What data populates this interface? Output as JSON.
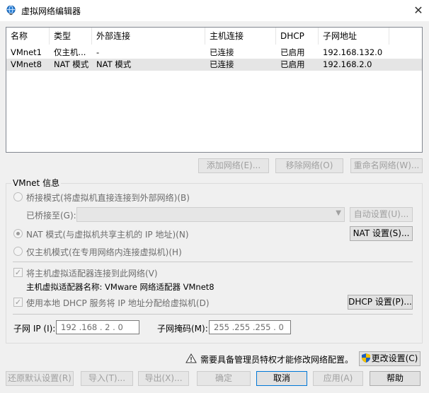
{
  "window": {
    "title": "虚拟网络编辑器",
    "close_glyph": "✕"
  },
  "table": {
    "headers": [
      "名称",
      "类型",
      "外部连接",
      "主机连接",
      "DHCP",
      "子网地址"
    ],
    "rows": [
      [
        "VMnet1",
        "仅主机...",
        "-",
        "已连接",
        "已启用",
        "192.168.132.0"
      ],
      [
        "VMnet8",
        "NAT 模式",
        "NAT 模式",
        "已连接",
        "已启用",
        "192.168.2.0"
      ]
    ],
    "selected_row": 1
  },
  "table_actions": {
    "add": "添加网络(E)...",
    "remove": "移除网络(O)",
    "rename": "重命名网络(W)..."
  },
  "vmnet_info": {
    "group_label": "VMnet 信息",
    "bridged_label": "桥接模式(将虚拟机直接连接到外部网络)(B)",
    "bridged_to_label": "已桥接至(G):",
    "bridged_to_value": "",
    "auto_settings": "自动设置(U)...",
    "nat_label": "NAT 模式(与虚拟机共享主机的 IP 地址)(N)",
    "nat_settings": "NAT 设置(S)...",
    "hostonly_label": "仅主机模式(在专用网络内连接虚拟机)(H)",
    "connect_adapter_label": "将主机虚拟适配器连接到此网络(V)",
    "adapter_name_label": "主机虚拟适配器名称: VMware 网络适配器 VMnet8",
    "dhcp_label": "使用本地 DHCP 服务将 IP 地址分配给虚拟机(D)",
    "dhcp_settings": "DHCP 设置(P)...",
    "subnet_ip_label": "子网 IP (I):",
    "subnet_ip_value": "192 .168 . 2 . 0",
    "subnet_mask_label": "子网掩码(M):",
    "subnet_mask_value": "255 .255 .255 . 0",
    "selected_mode": "nat",
    "connect_adapter_checked": true,
    "dhcp_checked": true
  },
  "admin_notice": {
    "text": "需要具备管理员特权才能修改网络配置。",
    "change_settings": "更改设置(C)"
  },
  "footer": {
    "restore_defaults": "还原默认设置(R)",
    "import": "导入(T)...",
    "export": "导出(X)...",
    "ok": "确定",
    "cancel": "取消",
    "apply": "应用(A)",
    "help": "帮助"
  },
  "colors": {
    "accent": "#0078d7",
    "selected_row": "#e5e5e5",
    "warning": "#f0c000",
    "shield_blue": "#1f5fbf",
    "shield_yellow": "#f2c200"
  },
  "icons": {
    "title": "network-globe-icon",
    "close": "close-icon",
    "warning": "warning-triangle-icon",
    "uac": "uac-shield-icon",
    "dropdown": "chevron-down-icon"
  }
}
